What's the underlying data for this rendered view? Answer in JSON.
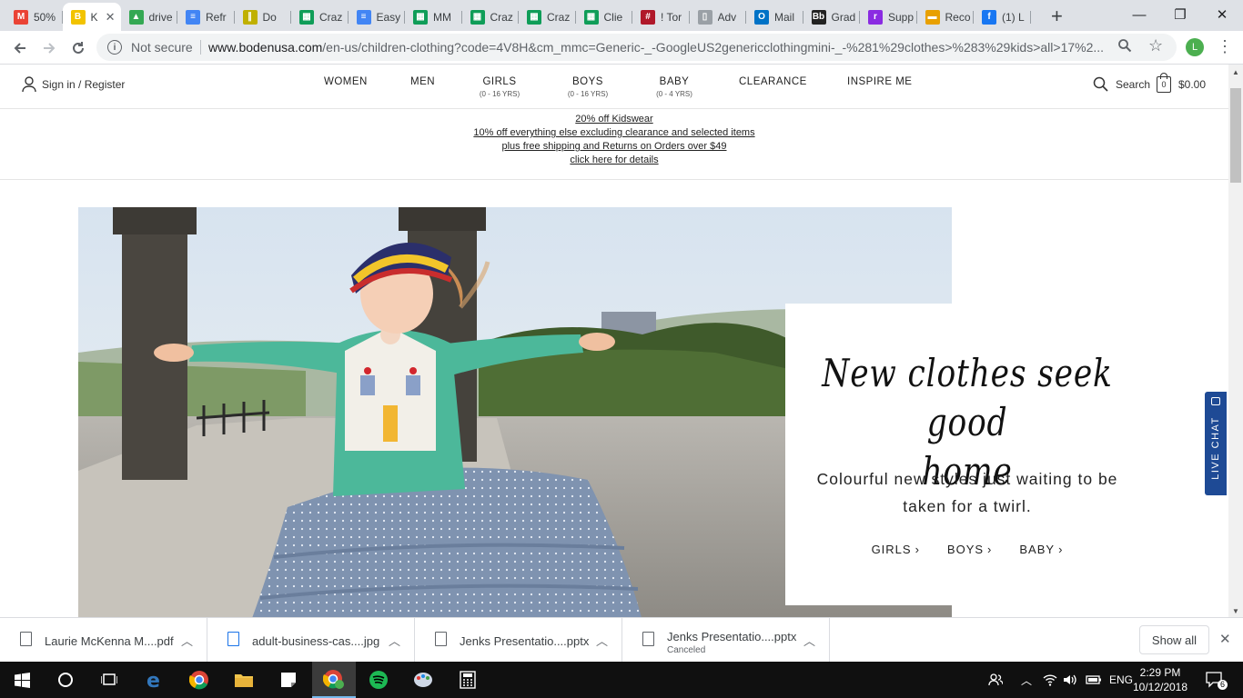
{
  "browser": {
    "tabs": [
      {
        "title": "50%",
        "icon": "gmail-icon",
        "color": "#ea4335",
        "glyph": "M"
      },
      {
        "title": "K",
        "icon": "boden-icon",
        "color": "#f2c300",
        "glyph": "B",
        "active": true
      },
      {
        "title": "drive",
        "icon": "google-drive-icon",
        "color": "#34a853",
        "glyph": "▲"
      },
      {
        "title": "Refr",
        "icon": "google-docs-icon",
        "color": "#4285f4",
        "glyph": "≡"
      },
      {
        "title": "Do",
        "icon": "bars-icon",
        "color": "#c0b000",
        "glyph": "∥"
      },
      {
        "title": "Craz",
        "icon": "google-sheets-icon",
        "color": "#0f9d58",
        "glyph": "▦"
      },
      {
        "title": "Easy",
        "icon": "google-docs-icon",
        "color": "#4285f4",
        "glyph": "≡"
      },
      {
        "title": "MM",
        "icon": "google-sheets-icon",
        "color": "#0f9d58",
        "glyph": "▦"
      },
      {
        "title": "Craz",
        "icon": "google-sheets-icon",
        "color": "#0f9d58",
        "glyph": "▦"
      },
      {
        "title": "Craz",
        "icon": "google-sheets-icon",
        "color": "#0f9d58",
        "glyph": "▦"
      },
      {
        "title": "Clie",
        "icon": "google-sheets-icon",
        "color": "#0f9d58",
        "glyph": "▦"
      },
      {
        "title": "! Tor",
        "icon": "pound-icon",
        "color": "#b0182a",
        "glyph": "#"
      },
      {
        "title": "Adv",
        "icon": "page-icon",
        "color": "#9aa0a6",
        "glyph": "▯"
      },
      {
        "title": "Mail",
        "icon": "outlook-icon",
        "color": "#0072c6",
        "glyph": "O"
      },
      {
        "title": "Grad",
        "icon": "blackboard-icon",
        "color": "#222222",
        "glyph": "Bb"
      },
      {
        "title": "Supp",
        "icon": "rra-icon",
        "color": "#8a2be2",
        "glyph": "r"
      },
      {
        "title": "Reco",
        "icon": "yellow-icon",
        "color": "#e8a000",
        "glyph": "▬"
      },
      {
        "title": "(1) L",
        "icon": "facebook-icon",
        "color": "#1877f2",
        "glyph": "f"
      }
    ],
    "new_tab": "+",
    "minimize": "—",
    "maximize": "❐",
    "close": "✕",
    "security_label": "Not secure",
    "url_host": "www.bodenusa.com",
    "url_path": "/en-us/children-clothing?code=4V8H&cm_mmc=Generic-_-GoogleUS2genericclothingmini-_-%281%29clothes>%283%29kids>all>17%2...",
    "profile_initial": "L"
  },
  "site": {
    "signin": "Sign in / Register",
    "nav": [
      {
        "label": "WOMEN",
        "sub": ""
      },
      {
        "label": "MEN",
        "sub": ""
      },
      {
        "label": "GIRLS",
        "sub": "(0 - 16 YRS)"
      },
      {
        "label": "BOYS",
        "sub": "(0 - 16 YRS)"
      },
      {
        "label": "BABY",
        "sub": "(0 - 4 YRS)"
      },
      {
        "label": "CLEARANCE",
        "sub": ""
      },
      {
        "label": "INSPIRE ME",
        "sub": ""
      }
    ],
    "search_label": "Search",
    "cart_count": "0",
    "cart_total": "$0.00",
    "promo": [
      "20% off Kidswear",
      "10% off everything else excluding clearance and selected items",
      "plus free shipping and Returns on Orders over $49",
      "click here for details"
    ],
    "hero": {
      "title_line1": "New clothes seek good",
      "title_line2": "home",
      "subtitle_line1": "Colourful new styles just waiting to be",
      "subtitle_line2": "taken for a twirl.",
      "links": [
        "GIRLS",
        "BOYS",
        "BABY"
      ]
    },
    "live_chat": "LIVE CHAT"
  },
  "downloads": {
    "items": [
      {
        "name": "Laurie McKenna M....pdf",
        "status": "",
        "type": "pdf"
      },
      {
        "name": "adult-business-cas....jpg",
        "status": "",
        "type": "jpg"
      },
      {
        "name": "Jenks Presentatio....pptx",
        "status": "",
        "type": "pptx"
      },
      {
        "name": "Jenks Presentatio....pptx",
        "status": "Canceled",
        "type": "pptx"
      }
    ],
    "show_all": "Show all",
    "close": "✕"
  },
  "taskbar": {
    "language": "ENG",
    "time": "2:29 PM",
    "date": "10/12/2018",
    "notification_count": "6"
  }
}
